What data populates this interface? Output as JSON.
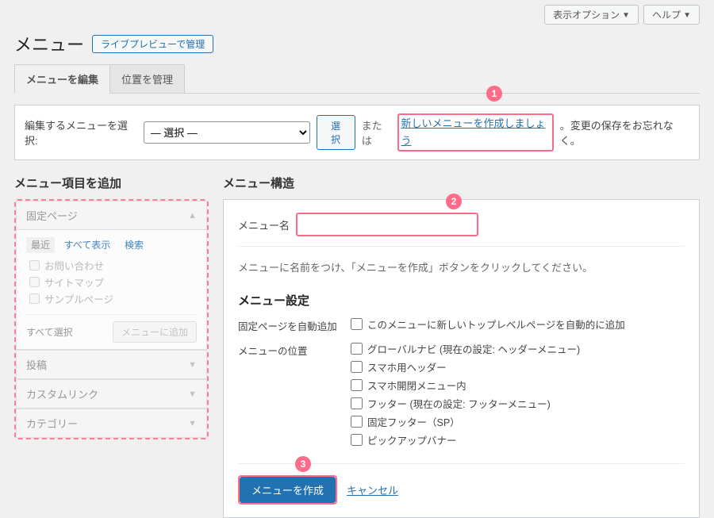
{
  "topbar": {
    "screen_options": "表示オプション",
    "help": "ヘルプ"
  },
  "header": {
    "title": "メニュー",
    "live_preview_btn": "ライブプレビューで管理"
  },
  "tabs": {
    "edit": "メニューを編集",
    "locations": "位置を管理"
  },
  "selector": {
    "label": "編集するメニューを選択:",
    "placeholder": "— 選択 —",
    "select_btn": "選択",
    "or_text": "または",
    "new_link": "新しいメニューを作成しましょう",
    "after_text": "。変更の保存をお忘れなく。",
    "annot": "1"
  },
  "left": {
    "heading": "メニュー項目を追加",
    "pages_title": "固定ページ",
    "sub_tabs": {
      "recent": "最近",
      "all": "すべて表示",
      "search": "検索"
    },
    "page_items": [
      "お問い合わせ",
      "サイトマップ",
      "サンプルページ"
    ],
    "select_all": "すべて選択",
    "add_btn": "メニューに追加",
    "posts": "投稿",
    "custom": "カスタムリンク",
    "categories": "カテゴリー"
  },
  "right": {
    "heading": "メニュー構造",
    "name_label": "メニュー名",
    "annot_name": "2",
    "instruction": "メニューに名前をつけ、「メニューを作成」ボタンをクリックしてください。",
    "settings_title": "メニュー設定",
    "auto_add_label": "固定ページを自動追加",
    "auto_add_opt": "このメニューに新しいトップレベルページを自動的に追加",
    "location_label": "メニューの位置",
    "locations": [
      "グローバルナビ (現在の設定: ヘッダーメニュー)",
      "スマホ用ヘッダー",
      "スマホ開閉メニュー内",
      "フッター (現在の設定: フッターメニュー)",
      "固定フッター（SP）",
      "ピックアップバナー"
    ],
    "annot_create": "3",
    "create_btn": "メニューを作成",
    "cancel": "キャンセル"
  }
}
